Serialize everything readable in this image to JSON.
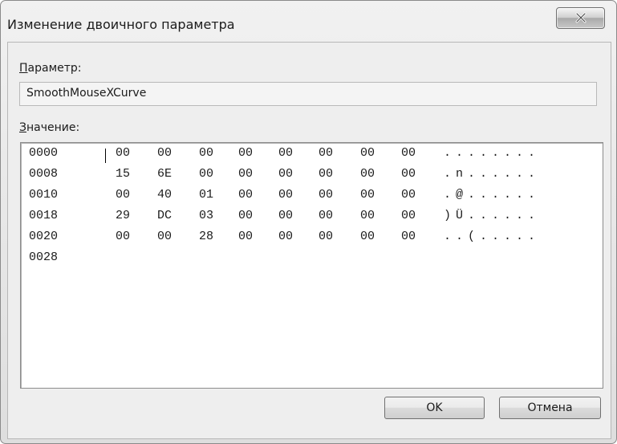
{
  "window": {
    "title": "Изменение двоичного параметра"
  },
  "param": {
    "label_accel": "П",
    "label_rest": "араметр:",
    "value": "SmoothMouseXCurve"
  },
  "value_section": {
    "label_accel": "З",
    "label_rest": "начение:"
  },
  "hex_rows": [
    {
      "addr": "0000",
      "bytes": [
        "00",
        "00",
        "00",
        "00",
        "00",
        "00",
        "00",
        "00"
      ],
      "ascii": "........"
    },
    {
      "addr": "0008",
      "bytes": [
        "15",
        "6E",
        "00",
        "00",
        "00",
        "00",
        "00",
        "00"
      ],
      "ascii": ".n......"
    },
    {
      "addr": "0010",
      "bytes": [
        "00",
        "40",
        "01",
        "00",
        "00",
        "00",
        "00",
        "00"
      ],
      "ascii": ".@......"
    },
    {
      "addr": "0018",
      "bytes": [
        "29",
        "DC",
        "03",
        "00",
        "00",
        "00",
        "00",
        "00"
      ],
      "ascii": ")Ü......"
    },
    {
      "addr": "0020",
      "bytes": [
        "00",
        "00",
        "28",
        "00",
        "00",
        "00",
        "00",
        "00"
      ],
      "ascii": "..(....."
    },
    {
      "addr": "0028",
      "bytes": [],
      "ascii": ""
    }
  ],
  "buttons": {
    "ok": "OK",
    "cancel": "Отмена"
  },
  "icons": {
    "close": "close-icon"
  },
  "colors": {
    "client_bg": "#eeeeee",
    "frame": "#8a8a8a"
  }
}
